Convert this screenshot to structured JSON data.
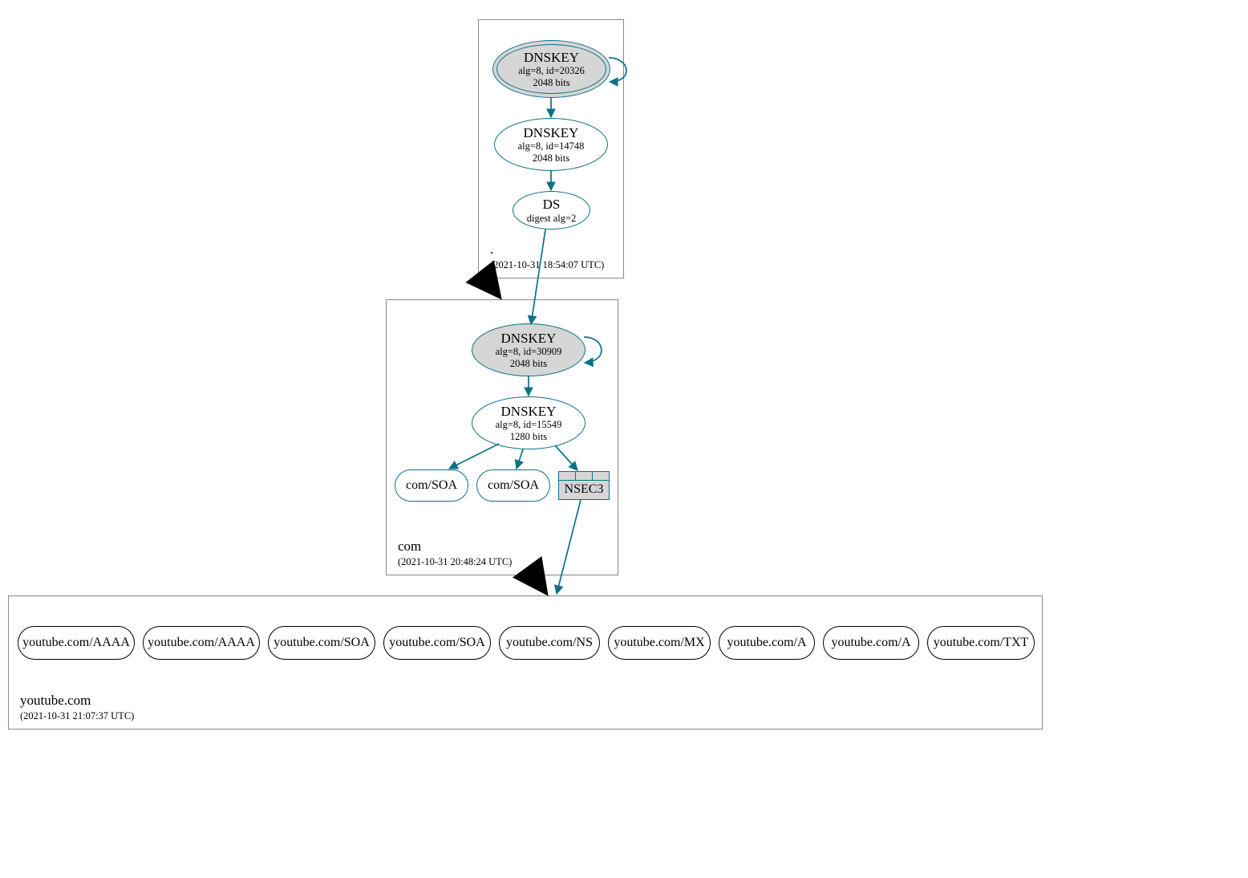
{
  "colors": {
    "teal": "#0B7285",
    "black": "#000",
    "grayfill": "#d6d6d6"
  },
  "zones": {
    "root": {
      "name": ".",
      "ts": "(2021-10-31 18:54:07 UTC)"
    },
    "com": {
      "name": "com",
      "ts": "(2021-10-31 20:48:24 UTC)"
    },
    "youtube": {
      "name": "youtube.com",
      "ts": "(2021-10-31 21:07:37 UTC)"
    }
  },
  "nodes": {
    "root_ksk": {
      "title": "DNSKEY",
      "line2": "alg=8, id=20326",
      "line3": "2048 bits"
    },
    "root_zsk": {
      "title": "DNSKEY",
      "line2": "alg=8, id=14748",
      "line3": "2048 bits"
    },
    "root_ds": {
      "title": "DS",
      "line2": "digest alg=2"
    },
    "com_ksk": {
      "title": "DNSKEY",
      "line2": "alg=8, id=30909",
      "line3": "2048 bits"
    },
    "com_zsk": {
      "title": "DNSKEY",
      "line2": "alg=8, id=15549",
      "line3": "1280 bits"
    },
    "com_soa1": "com/SOA",
    "com_soa2": "com/SOA",
    "nsec3": "NSEC3",
    "yt": [
      "youtube.com/AAAA",
      "youtube.com/AAAA",
      "youtube.com/SOA",
      "youtube.com/SOA",
      "youtube.com/NS",
      "youtube.com/MX",
      "youtube.com/A",
      "youtube.com/A",
      "youtube.com/TXT"
    ]
  }
}
